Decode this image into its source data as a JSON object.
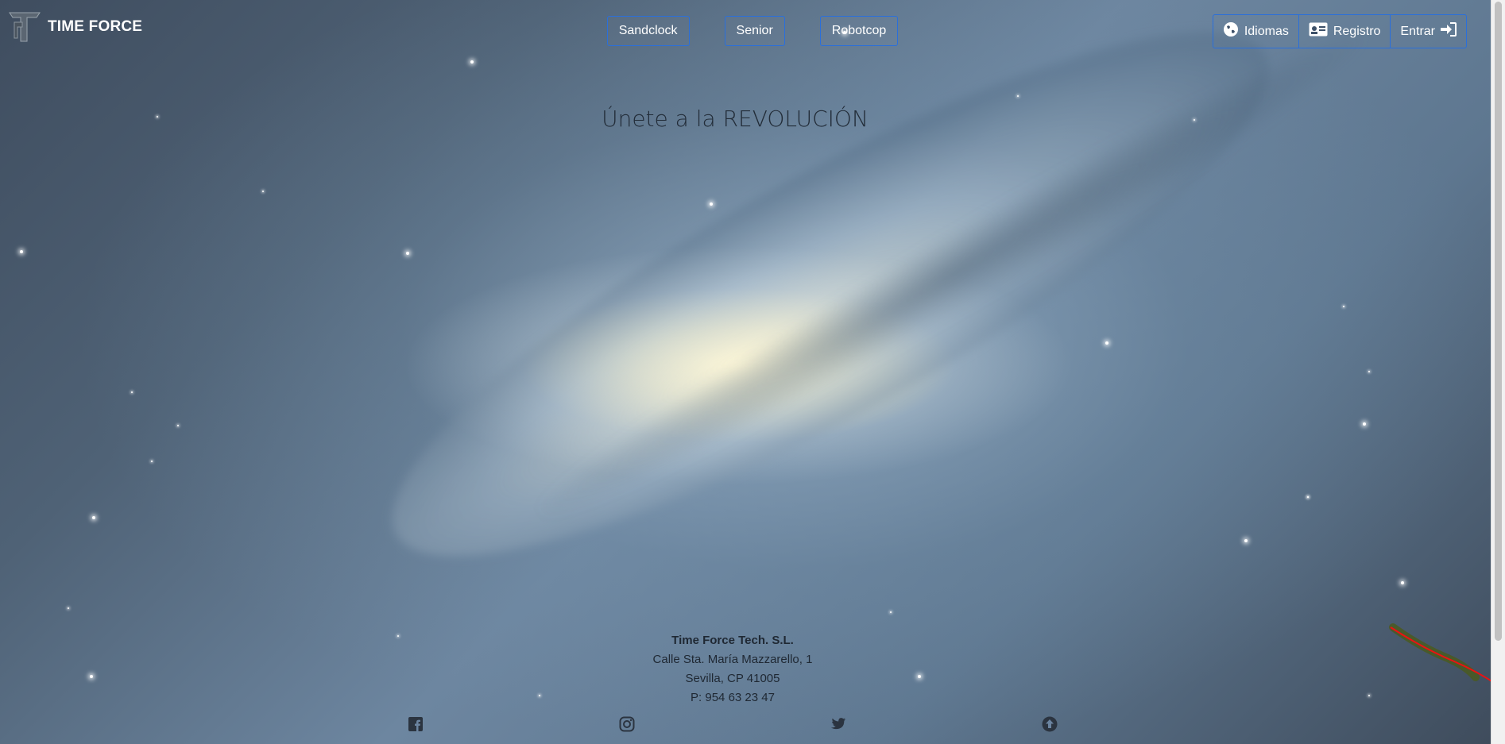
{
  "brand": {
    "name": "TIME FORCE",
    "logo_icon": "tf-logo-icon"
  },
  "center_nav": [
    {
      "label": "Sandclock"
    },
    {
      "label": "Senior"
    },
    {
      "label": "Robotcop"
    }
  ],
  "right_nav": {
    "languages": {
      "label": "Idiomas",
      "icon": "globe-icon"
    },
    "register": {
      "label": "Registro",
      "icon": "id-card-icon"
    },
    "login": {
      "label": "Entrar",
      "icon": "sign-in-icon"
    }
  },
  "hero": {
    "title": "Únete a la REVOLUCIÓN"
  },
  "footer": {
    "company": "Time Force Tech. S.L.",
    "address": "Calle Sta. María Mazzarello, 1",
    "city": "Sevilla, CP 41005",
    "phone": "P: 954 63 23 47"
  },
  "social": [
    {
      "icon": "facebook-icon"
    },
    {
      "icon": "instagram-icon"
    },
    {
      "icon": "twitter-icon"
    },
    {
      "icon": "arrow-up-circle-icon"
    }
  ],
  "colors": {
    "accent_border": "#2a6fdb",
    "text_dark": "#222c38",
    "text_light": "#ffffff"
  }
}
